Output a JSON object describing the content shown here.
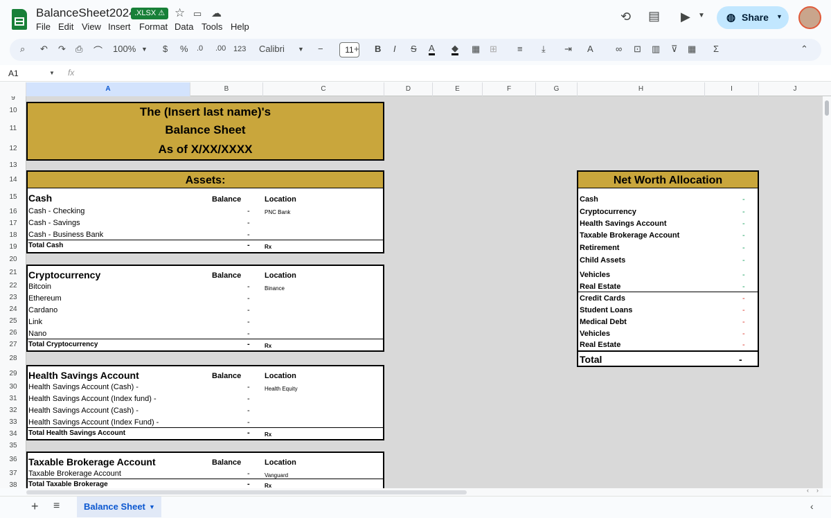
{
  "app": {
    "title": "BalanceSheet2024",
    "badge": ".XLSX ⚠"
  },
  "menu": [
    "File",
    "Edit",
    "View",
    "Insert",
    "Format",
    "Data",
    "Tools",
    "Help"
  ],
  "share_label": "Share",
  "toolbar": {
    "zoom": "100%",
    "currency": "$",
    "percent": "%",
    "dec_minus": ".0",
    "dec_plus": ".00",
    "number_format": "123",
    "font": "Calibri",
    "font_size": "11"
  },
  "namebox": "A1",
  "fx": "fx",
  "columns": [
    "A",
    "B",
    "C",
    "D",
    "E",
    "F",
    "G",
    "H",
    "I",
    "J"
  ],
  "rows": [
    "9",
    "10",
    "11",
    "12",
    "13",
    "14",
    "15",
    "16",
    "17",
    "18",
    "19",
    "20",
    "21",
    "22",
    "23",
    "24",
    "25",
    "26",
    "27",
    "28",
    "29",
    "30",
    "31",
    "32",
    "33",
    "34",
    "35",
    "36",
    "37",
    "38"
  ],
  "title_block": {
    "line1": "The (Insert last name)'s",
    "line2": "Balance Sheet",
    "line3": "As of X/XX/XXXX"
  },
  "assets_header": "Assets:",
  "col_balance": "Balance",
  "col_location": "Location",
  "dash": "-",
  "rx": "Rx",
  "sections": [
    {
      "title": "Cash",
      "items": [
        "Cash - Checking",
        "Cash - Savings",
        "Cash - Business Bank"
      ],
      "total": "Total Cash",
      "location": "PNC Bank"
    },
    {
      "title": "Cryptocurrency",
      "items": [
        "Bitcoin",
        "Ethereum",
        "Cardano",
        "Link",
        "Nano"
      ],
      "total": "Total Cryptocurrency",
      "location": "Binance"
    },
    {
      "title": "Health Savings Account",
      "items": [
        "Health Savings Account (Cash) -",
        "Health Savings Account (Index fund) -",
        "Health Savings Account (Cash) -",
        "Health Savings Account (Index Fund) -"
      ],
      "total": "Total Health Savings Account",
      "location": "Health Equity"
    },
    {
      "title": "Taxable Brokerage Account",
      "items": [
        "Taxable Brokerage Account"
      ],
      "total": "Total Taxable Brokerage",
      "location": "Vanguard"
    }
  ],
  "net_worth": {
    "title": "Net Worth Allocation",
    "assets": [
      "Cash",
      "Cryptocurrency",
      "Health Savings Account",
      "Taxable Brokerage Account",
      "Retirement",
      "Child Assets",
      "Vehicles",
      "Real Estate"
    ],
    "liabilities": [
      "Credit Cards",
      "Student Loans",
      "Medical Debt",
      "Vehicles",
      "Real Estate"
    ],
    "total_label": "Total",
    "total_value": "-",
    "asset_color": "#0f9d58",
    "liability_color": "#d93025"
  },
  "sheet_tab": "Balance Sheet",
  "accent": "#c9a63c"
}
